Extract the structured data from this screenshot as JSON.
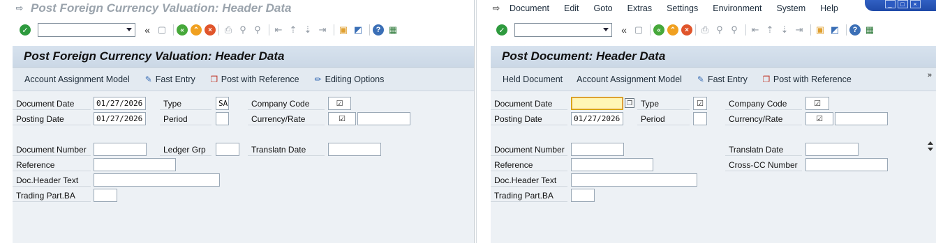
{
  "left": {
    "window_title": "Post Foreign Currency Valuation: Header Data",
    "screen_title": "Post Foreign Currency Valuation: Header Data",
    "app_toolbar": [
      "Account Assignment Model",
      "Fast Entry",
      "Post with Reference",
      "Editing Options"
    ],
    "fields": {
      "document_date": {
        "label": "Document Date",
        "value": "01/27/2026"
      },
      "posting_date": {
        "label": "Posting Date",
        "value": "01/27/2026"
      },
      "type": {
        "label": "Type",
        "value": "SA"
      },
      "period": {
        "label": "Period",
        "value": ""
      },
      "company_code": {
        "label": "Company Code",
        "value": ""
      },
      "currency_rate": {
        "label": "Currency/Rate",
        "value": ""
      },
      "document_number": {
        "label": "Document Number",
        "value": ""
      },
      "ledger_grp": {
        "label": "Ledger Grp",
        "value": ""
      },
      "translatn_date": {
        "label": "Translatn Date",
        "value": ""
      },
      "reference": {
        "label": "Reference",
        "value": ""
      },
      "doc_header_text": {
        "label": "Doc.Header Text",
        "value": ""
      },
      "trading_part_ba": {
        "label": "Trading Part.BA",
        "value": ""
      }
    }
  },
  "right": {
    "menu": [
      "Document",
      "Edit",
      "Goto",
      "Extras",
      "Settings",
      "Environment",
      "System",
      "Help"
    ],
    "screen_title": "Post Document: Header Data",
    "app_toolbar": [
      "Held Document",
      "Account Assignment Model",
      "Fast Entry",
      "Post with Reference"
    ],
    "more_indicator": "»",
    "fields": {
      "document_date": {
        "label": "Document Date",
        "value": ""
      },
      "posting_date": {
        "label": "Posting Date",
        "value": "01/27/2026"
      },
      "type": {
        "label": "Type",
        "value": ""
      },
      "period": {
        "label": "Period",
        "value": ""
      },
      "company_code": {
        "label": "Company Code",
        "value": ""
      },
      "currency_rate": {
        "label": "Currency/Rate",
        "value": ""
      },
      "document_number": {
        "label": "Document Number",
        "value": ""
      },
      "translatn_date": {
        "label": "Translatn Date",
        "value": ""
      },
      "reference": {
        "label": "Reference",
        "value": ""
      },
      "cross_cc_number": {
        "label": "Cross-CC Number",
        "value": ""
      },
      "doc_header_text": {
        "label": "Doc.Header Text",
        "value": ""
      },
      "trading_part_ba": {
        "label": "Trading Part.BA",
        "value": ""
      }
    }
  },
  "toolbar": {
    "back_symbol": "«",
    "check_glyph": "✓"
  },
  "icons": {
    "window": "exit-icon",
    "enter": "enter-check-icon",
    "save": "save-icon",
    "back": "back-icon",
    "exit": "exit-icon",
    "cancel": "cancel-icon",
    "print": "print-icon",
    "find": "find-icon",
    "help": "help-icon"
  },
  "colors": {
    "accent": "#2e9a3e",
    "focus_field": "#fff6b5",
    "title_bar": "#3a6bd0"
  }
}
